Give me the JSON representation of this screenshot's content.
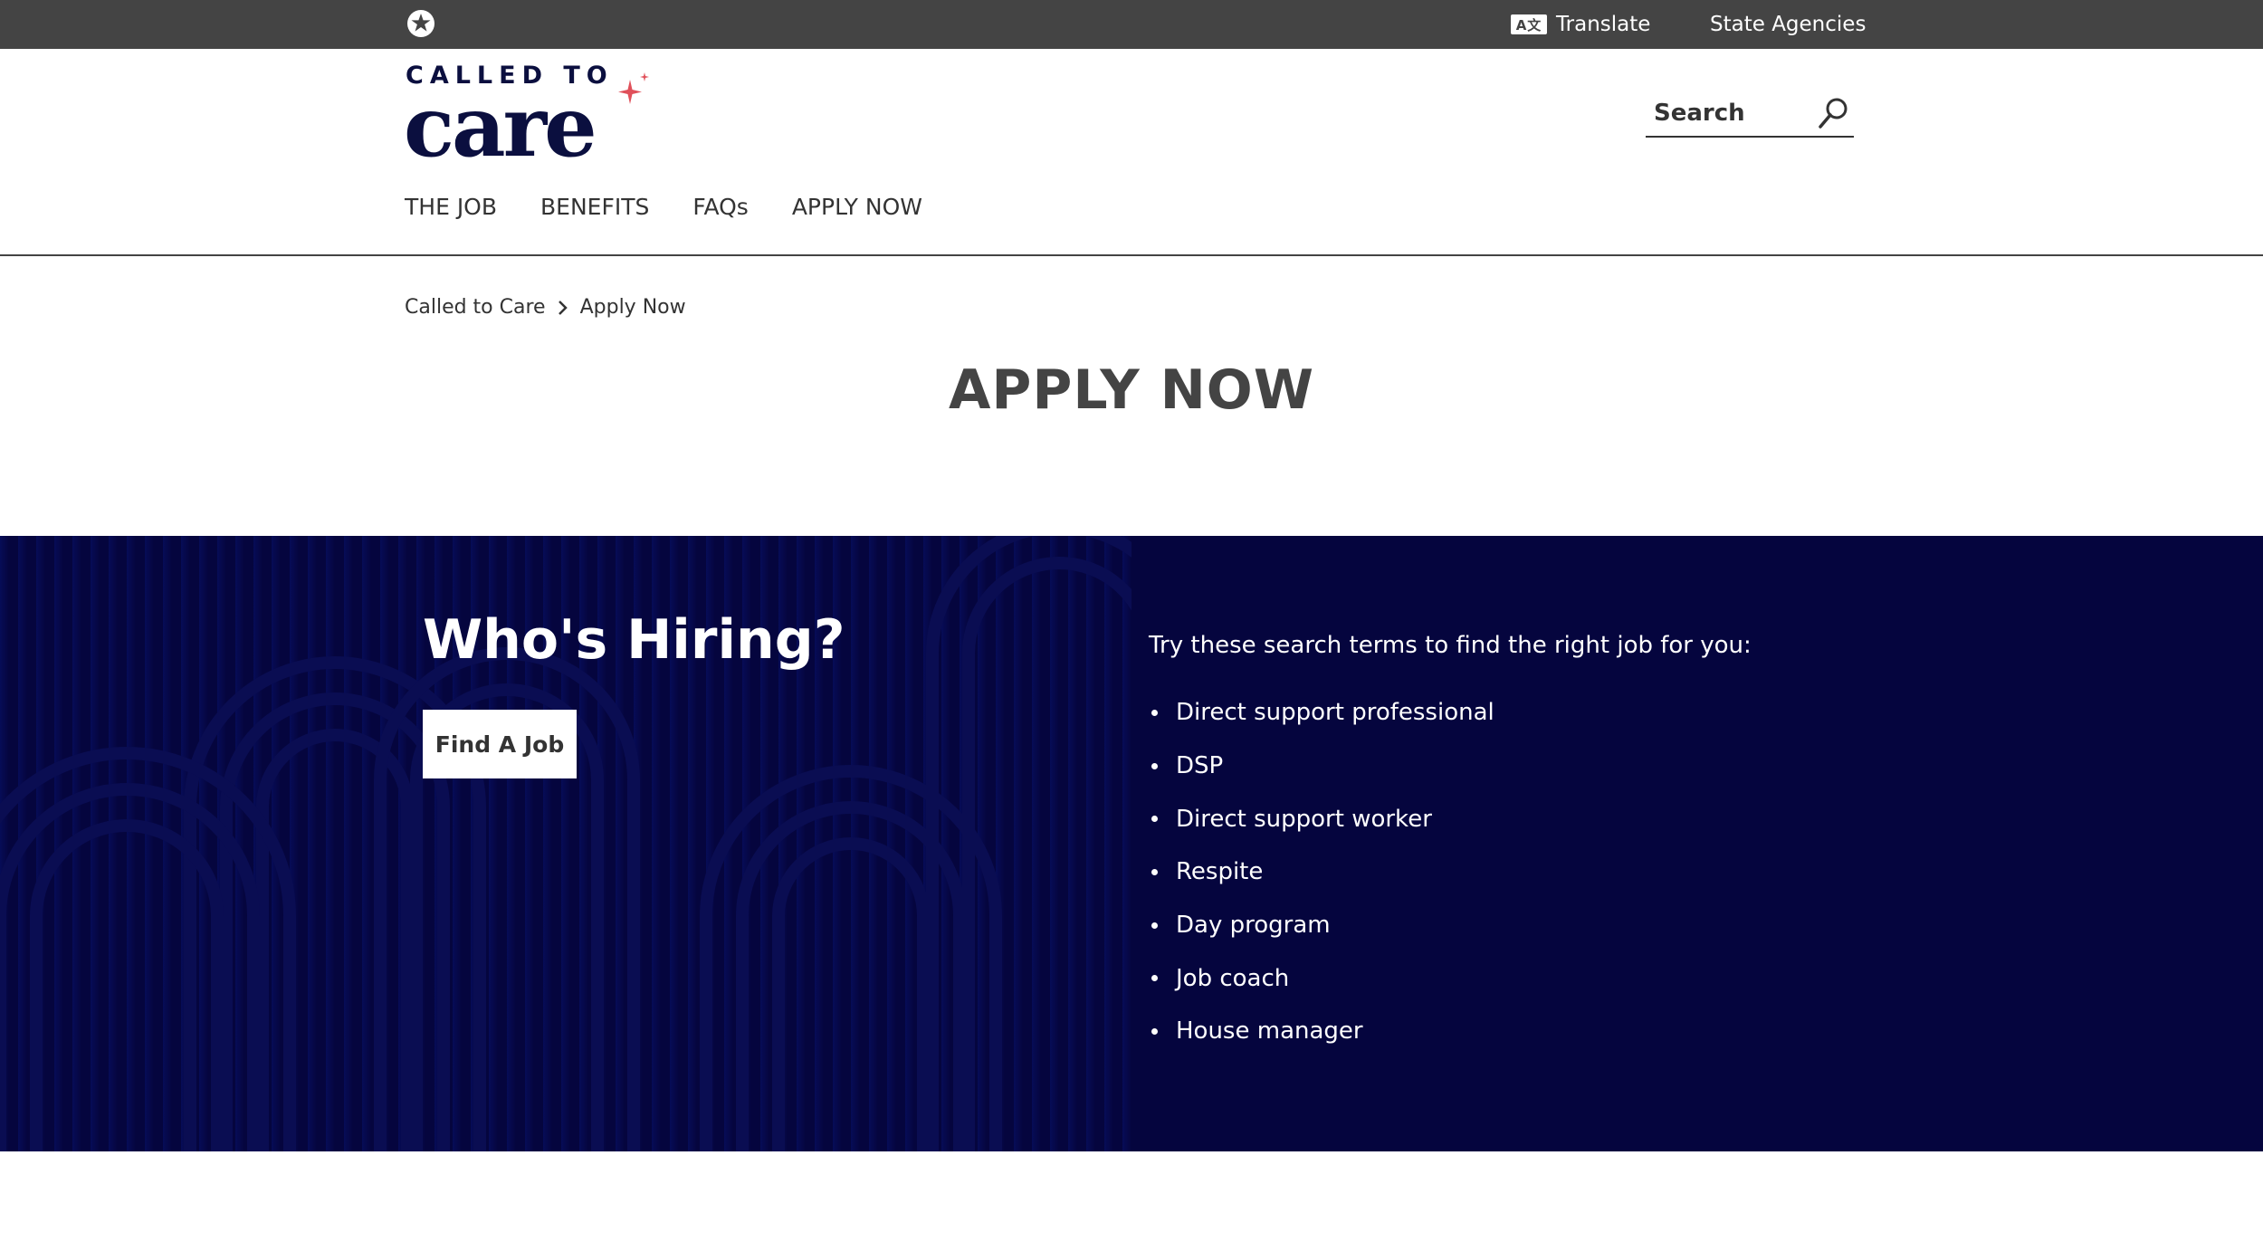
{
  "utility_bar": {
    "translate_icon_text": "A文",
    "translate_label": "Translate",
    "agencies_label": "State Agencies"
  },
  "logo": {
    "line1": "CALLED TO",
    "line2": "care"
  },
  "search": {
    "placeholder": "Search"
  },
  "nav": {
    "items": [
      "THE JOB",
      "BENEFITS",
      "FAQs",
      "APPLY NOW"
    ]
  },
  "breadcrumb": {
    "home": "Called to Care",
    "current": "Apply Now"
  },
  "page": {
    "title": "APPLY NOW"
  },
  "hiring": {
    "heading": "Who's Hiring?",
    "button": "Find A Job",
    "intro": "Try these search terms to find the right job for you:",
    "terms": [
      "Direct support professional",
      "DSP",
      "Direct support worker",
      "Respite",
      "Day program",
      "Job coach",
      "House manager"
    ]
  },
  "colors": {
    "utility_bg": "#444444",
    "brand_navy": "#0b0f3f",
    "hiring_bg": "#05053e",
    "accent_star": "#e0505a"
  }
}
